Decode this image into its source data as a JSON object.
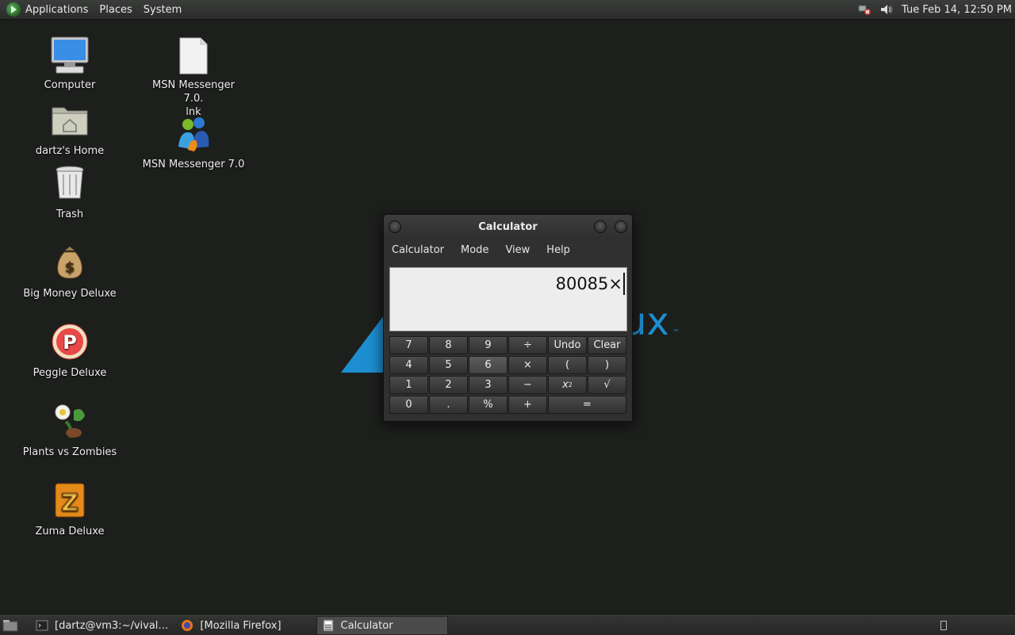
{
  "top_panel": {
    "menus": [
      "Applications",
      "Places",
      "System"
    ],
    "clock": "Tue Feb 14, 12:50 PM",
    "tray": [
      "network-warning-icon",
      "volume-icon"
    ]
  },
  "desktop_icons": {
    "computer": "Computer",
    "home": "dartz's Home",
    "trash": "Trash",
    "big_money": "Big Money Deluxe",
    "peggle": "Peggle Deluxe",
    "pvz": "Plants vs Zombies",
    "zuma": "Zuma Deluxe",
    "msn_lnk": "MSN Messenger 7.0.\nlnk",
    "msn": "MSN Messenger 7.0"
  },
  "wallpaper": {
    "logo_text": "ux",
    "tm": "™",
    "accent": "#1d8fd0"
  },
  "calculator": {
    "title": "Calculator",
    "menu": [
      "Calculator",
      "Mode",
      "View",
      "Help"
    ],
    "display": "80085×",
    "keys": {
      "k7": "7",
      "k8": "8",
      "k9": "9",
      "div": "÷",
      "undo": "Undo",
      "clear": "Clear",
      "k4": "4",
      "k5": "5",
      "k6": "6",
      "mul": "×",
      "lparen": "(",
      "rparen": ")",
      "k1": "1",
      "k2": "2",
      "k3": "3",
      "minus": "−",
      "sq": "x",
      "sqrt": "√",
      "k0": "0",
      "dot": ".",
      "pct": "%",
      "plus": "+",
      "eq": "="
    }
  },
  "taskbar": {
    "tasks": [
      "[dartz@vm3:~/vival…",
      "[Mozilla Firefox]",
      "Calculator"
    ]
  }
}
